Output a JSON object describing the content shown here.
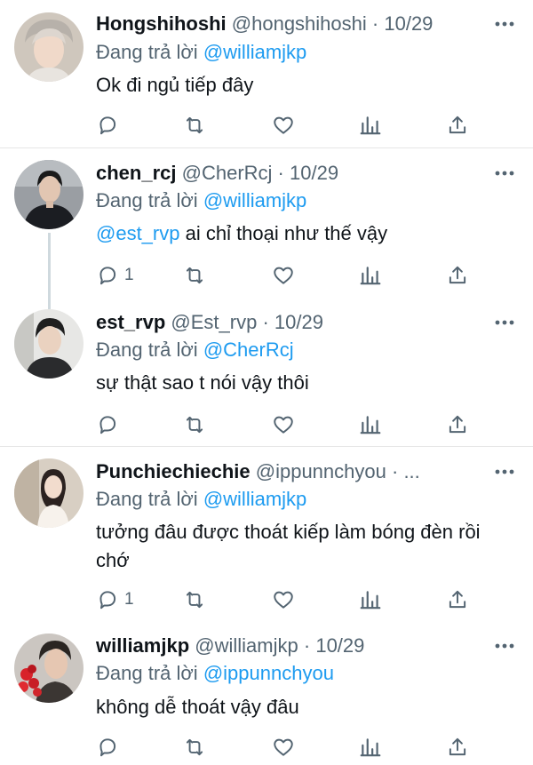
{
  "tweets": [
    {
      "name": "Hongshihoshi",
      "handle": "@hongshihoshi",
      "dot": "·",
      "date": "10/29",
      "reply_prefix": "Đang trả lời",
      "reply_to": "@williamjkp",
      "body_mention": "",
      "body": "Ok đi ngủ tiếp đây",
      "reply_count": ""
    },
    {
      "name": "chen_rcj",
      "handle": "@CherRcj",
      "dot": "·",
      "date": "10/29",
      "reply_prefix": "Đang trả lời",
      "reply_to": "@williamjkp",
      "body_mention": "@est_rvp",
      "body": " ai chỉ thoại như thế vậy",
      "reply_count": "1"
    },
    {
      "name": "est_rvp",
      "handle": "@Est_rvp",
      "dot": "·",
      "date": "10/29",
      "reply_prefix": "Đang trả lời",
      "reply_to": "@CherRcj",
      "body_mention": "",
      "body": "sự thật sao t nói vậy thôi",
      "reply_count": ""
    },
    {
      "name": "Punchiechiechie",
      "handle": "@ippunnchyou",
      "dot": "·",
      "date": "...",
      "reply_prefix": "Đang trả lời",
      "reply_to": "@williamjkp",
      "body_mention": "",
      "body": "tưởng đâu được thoát kiếp làm bóng đèn rồi chớ",
      "reply_count": "1"
    },
    {
      "name": "williamjkp",
      "handle": "@williamjkp",
      "dot": "·",
      "date": "10/29",
      "reply_prefix": "Đang trả lời",
      "reply_to": "@ippunnchyou",
      "body_mention": "",
      "body": "không dễ thoát vậy đâu",
      "reply_count": ""
    }
  ],
  "icons": {
    "reply": "reply-icon",
    "retweet": "retweet-icon",
    "like": "heart-icon",
    "views": "analytics-icon",
    "share": "share-icon",
    "more": "more-icon"
  },
  "colors": {
    "link": "#1d9bf0",
    "secondary": "#536471",
    "text": "#0f1419",
    "thread_line": "#cfd9de"
  }
}
